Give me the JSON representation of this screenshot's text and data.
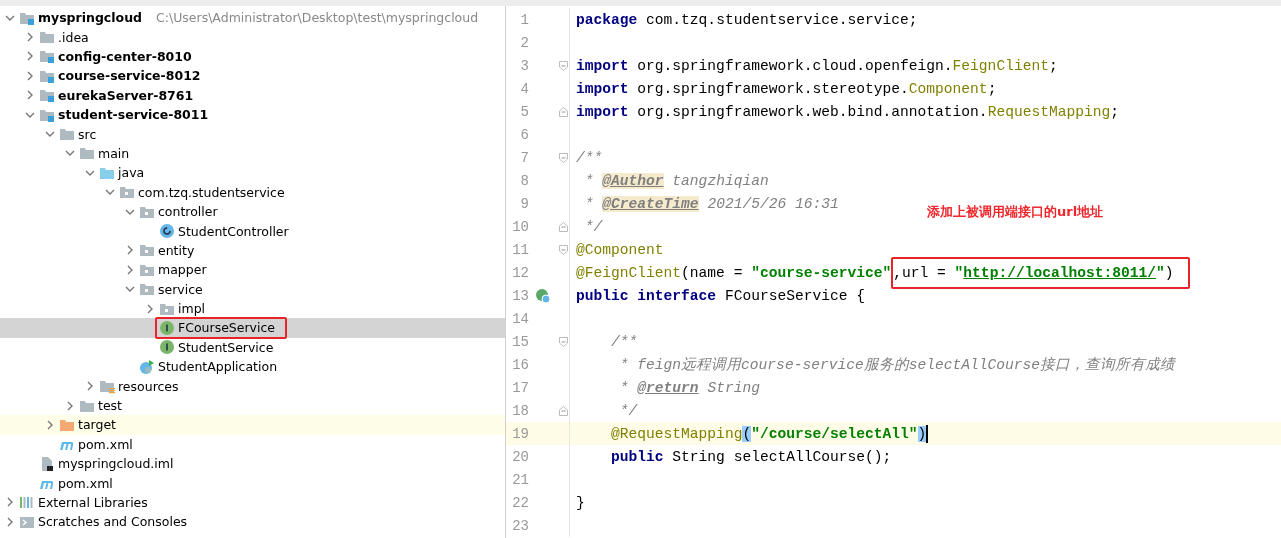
{
  "project_tree": [
    {
      "label": "myspringcloud",
      "kind": "module",
      "bold": true,
      "path": "C:\\Users\\Administrator\\Desktop\\test\\myspringcloud",
      "expanded": true,
      "selected": false,
      "children": [
        {
          "label": ".idea",
          "kind": "folder",
          "expanded": false,
          "selected": false
        },
        {
          "label": "config-center-8010",
          "kind": "module",
          "bold": true,
          "expanded": false,
          "selected": false
        },
        {
          "label": "course-service-8012",
          "kind": "module",
          "bold": true,
          "expanded": false,
          "selected": false
        },
        {
          "label": "eurekaServer-8761",
          "kind": "module",
          "bold": true,
          "expanded": false,
          "selected": false
        },
        {
          "label": "student-service-8011",
          "kind": "module",
          "bold": true,
          "expanded": true,
          "selected": false,
          "children": [
            {
              "label": "src",
              "kind": "folder",
              "expanded": true,
              "selected": false,
              "children": [
                {
                  "label": "main",
                  "kind": "folder",
                  "expanded": true,
                  "selected": false,
                  "children": [
                    {
                      "label": "java",
                      "kind": "source",
                      "expanded": true,
                      "selected": false,
                      "children": [
                        {
                          "label": "com.tzq.studentservice",
                          "kind": "package",
                          "expanded": true,
                          "selected": false,
                          "children": [
                            {
                              "label": "controller",
                              "kind": "package",
                              "expanded": true,
                              "selected": false,
                              "children": [
                                {
                                  "label": "StudentController",
                                  "kind": "class",
                                  "selected": false
                                }
                              ]
                            },
                            {
                              "label": "entity",
                              "kind": "package",
                              "expanded": false,
                              "selected": false
                            },
                            {
                              "label": "mapper",
                              "kind": "package",
                              "expanded": false,
                              "selected": false
                            },
                            {
                              "label": "service",
                              "kind": "package",
                              "expanded": true,
                              "selected": false,
                              "children": [
                                {
                                  "label": "impl",
                                  "kind": "package",
                                  "expanded": false,
                                  "selected": false
                                },
                                {
                                  "label": "FCourseService",
                                  "kind": "interface",
                                  "selected": true,
                                  "callout": true
                                },
                                {
                                  "label": "StudentService",
                                  "kind": "interface",
                                  "selected": false
                                }
                              ]
                            },
                            {
                              "label": "StudentApplication",
                              "kind": "app",
                              "selected": false
                            }
                          ]
                        }
                      ]
                    },
                    {
                      "label": "resources",
                      "kind": "resources",
                      "expanded": false,
                      "selected": false
                    }
                  ]
                },
                {
                  "label": "test",
                  "kind": "folder",
                  "expanded": false,
                  "selected": false
                }
              ]
            },
            {
              "label": "target",
              "kind": "excluded",
              "expanded": false,
              "selected": false
            },
            {
              "label": "pom.xml",
              "kind": "maven",
              "selected": false
            }
          ]
        },
        {
          "label": "myspringcloud.iml",
          "kind": "iml",
          "selected": false
        },
        {
          "label": "pom.xml",
          "kind": "maven",
          "selected": false
        }
      ]
    },
    {
      "label": "External Libraries",
      "kind": "libraries",
      "expanded": false,
      "selected": false
    },
    {
      "label": "Scratches and Consoles",
      "kind": "scratches",
      "expanded": false,
      "selected": false
    }
  ],
  "editor": {
    "note": "添加上被调用端接口的url地址",
    "lines": [
      {
        "number": "1",
        "current": false,
        "tokens": [
          {
            "kind": "keyword",
            "text": "package"
          },
          {
            "kind": "plain",
            "text": " com.tzq.studentservice.service;"
          }
        ]
      },
      {
        "number": "2",
        "current": false
      },
      {
        "number": "3",
        "current": false,
        "fold_open": true,
        "tokens": [
          {
            "kind": "keyword",
            "text": "import"
          },
          {
            "kind": "plain",
            "text": " org.springframework.cloud.openfeign."
          },
          {
            "kind": "annotation",
            "text": "FeignClient"
          },
          {
            "kind": "plain",
            "text": ";"
          }
        ]
      },
      {
        "number": "4",
        "current": false,
        "tokens": [
          {
            "kind": "keyword",
            "text": "import"
          },
          {
            "kind": "plain",
            "text": " org.springframework.stereotype."
          },
          {
            "kind": "annotation",
            "text": "Component"
          },
          {
            "kind": "plain",
            "text": ";"
          }
        ]
      },
      {
        "number": "5",
        "current": false,
        "fold_close": true,
        "tokens": [
          {
            "kind": "keyword",
            "text": "import"
          },
          {
            "kind": "plain",
            "text": " org.springframework.web.bind.annotation."
          },
          {
            "kind": "annotation",
            "text": "RequestMapping"
          },
          {
            "kind": "plain",
            "text": ";"
          }
        ]
      },
      {
        "number": "6",
        "current": false
      },
      {
        "number": "7",
        "current": false,
        "fold_open": true,
        "tokens": [
          {
            "kind": "comment",
            "text": "/**"
          }
        ]
      },
      {
        "number": "8",
        "current": false,
        "tokens": [
          {
            "kind": "comment",
            "text": " * "
          },
          {
            "kind": "doc-tag-marked",
            "text": "@Author"
          },
          {
            "kind": "comment",
            "text": " tangzhiqian"
          }
        ]
      },
      {
        "number": "9",
        "current": false,
        "tokens": [
          {
            "kind": "comment",
            "text": " * "
          },
          {
            "kind": "doc-tag-marked",
            "text": "@CreateTime"
          },
          {
            "kind": "comment",
            "text": " 2021/5/26 16:31"
          }
        ]
      },
      {
        "number": "10",
        "current": false,
        "fold_close": true,
        "tokens": [
          {
            "kind": "comment",
            "text": " */"
          }
        ]
      },
      {
        "number": "11",
        "current": false,
        "fold_open": true,
        "tokens": [
          {
            "kind": "annotation",
            "text": "@Component"
          }
        ]
      },
      {
        "number": "12",
        "current": false,
        "tokens": [
          {
            "kind": "annotation",
            "text": "@FeignClient"
          },
          {
            "kind": "plain",
            "text": "(name = "
          },
          {
            "kind": "string",
            "text": "\"course-service\""
          }
        ],
        "boxed": [
          {
            "kind": "plain",
            "text": ",url = "
          },
          {
            "kind": "string",
            "text": "\""
          },
          {
            "kind": "url",
            "text": "http://localhost:8011/"
          },
          {
            "kind": "string",
            "text": "\""
          },
          {
            "kind": "plain",
            "text": ")"
          }
        ]
      },
      {
        "number": "13",
        "current": false,
        "implemented_marker": true,
        "tokens": [
          {
            "kind": "keyword",
            "text": "public interface"
          },
          {
            "kind": "plain",
            "text": " FCourseService {"
          }
        ]
      },
      {
        "number": "14",
        "current": false
      },
      {
        "number": "15",
        "current": false,
        "fold_open": true,
        "tokens": [
          {
            "kind": "comment",
            "text": "    /**"
          }
        ]
      },
      {
        "number": "16",
        "current": false,
        "tokens": [
          {
            "kind": "comment",
            "text": "     * feign远程调用course-service服务的selectAllCourse接口，查询所有成绩"
          }
        ]
      },
      {
        "number": "17",
        "current": false,
        "tokens": [
          {
            "kind": "comment",
            "text": "     * "
          },
          {
            "kind": "doc-tag",
            "text": "@return"
          },
          {
            "kind": "comment",
            "text": " String"
          }
        ]
      },
      {
        "number": "18",
        "current": false,
        "fold_close": true,
        "tokens": [
          {
            "kind": "comment",
            "text": "     */"
          }
        ]
      },
      {
        "number": "19",
        "current": true,
        "tokens": [
          {
            "kind": "annotation",
            "text": "    @RequestMapping"
          },
          {
            "kind": "brace-match",
            "text": "("
          },
          {
            "kind": "string",
            "text": "\"/course/selectAll\""
          },
          {
            "kind": "brace-match",
            "text": ")"
          }
        ]
      },
      {
        "number": "20",
        "current": false,
        "tokens": [
          {
            "kind": "keyword-light",
            "text": "    public"
          },
          {
            "kind": "plain",
            "text": " String selectAllCourse();"
          }
        ]
      },
      {
        "number": "21",
        "current": false
      },
      {
        "number": "22",
        "current": false,
        "tokens": [
          {
            "kind": "plain",
            "text": "}"
          }
        ]
      },
      {
        "number": "23",
        "current": false
      }
    ]
  }
}
